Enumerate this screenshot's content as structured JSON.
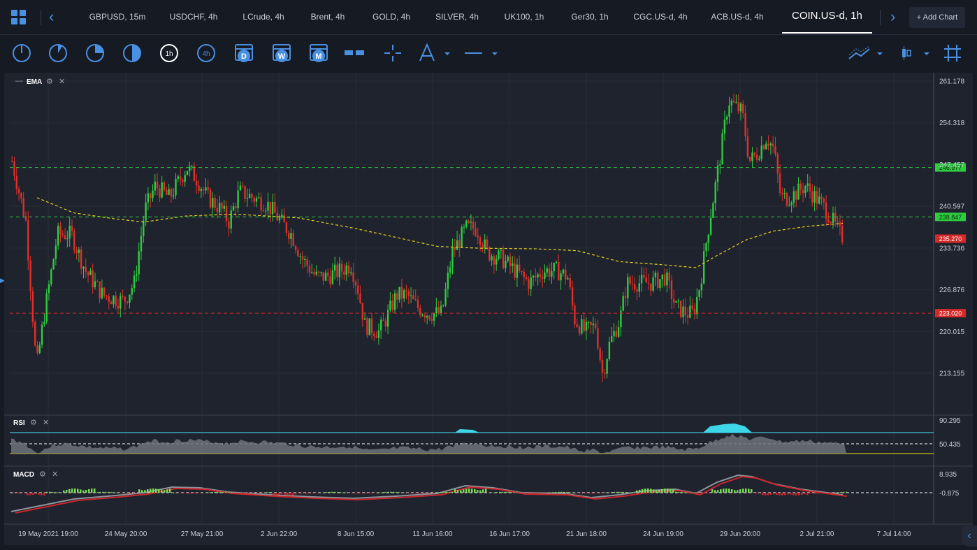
{
  "tabs": [
    {
      "label": "GBPUSD, 15m"
    },
    {
      "label": "USDCHF, 4h"
    },
    {
      "label": "LCrude, 4h"
    },
    {
      "label": "Brent, 4h"
    },
    {
      "label": "GOLD, 4h"
    },
    {
      "label": "SILVER, 4h"
    },
    {
      "label": "UK100, 1h"
    },
    {
      "label": "Ger30, 1h"
    },
    {
      "label": "CGC.US-d, 4h"
    },
    {
      "label": "ACB.US-d, 4h"
    },
    {
      "label": "COIN.US-d, 1h",
      "active": true
    }
  ],
  "add_chart": "+ Add Chart",
  "toolbar": {
    "timeframe_1h_label": "1h",
    "timeframe_4h_label": "4h",
    "day_label": "D",
    "week_label": "W",
    "month_label": "M"
  },
  "indicators": {
    "main": "EMA",
    "rsi": "RSI",
    "macd": "MACD"
  },
  "colors": {
    "up": "#2ecc40",
    "down": "#e0302a",
    "ema": "#e8d21a",
    "green_line": "#2ecc40",
    "red_line": "#d42a2a",
    "accent": "#4a90e2",
    "rsi_fill": "#6f737b",
    "rsi_high": "#3dd6e8",
    "macd_line": "#c8262b"
  },
  "chart_data": {
    "type": "candlestick",
    "y_ticks": [
      "261.178",
      "254.318",
      "247.457",
      "240.597",
      "233.736",
      "226.876",
      "220.015",
      "213.155"
    ],
    "x_ticks": [
      "19 May 2021 19:00",
      "24 May 20:00",
      "27 May 21:00",
      "2 Jun 22:00",
      "8 Jun 15:00",
      "11 Jun 16:00",
      "16 Jun 17:00",
      "21 Jun 18:00",
      "24 Jun 19:00",
      "29 Jun 20:00",
      "2 Jul 21:00",
      "7 Jul 14:00"
    ],
    "ylim": [
      208,
      262
    ],
    "horizontal_lines": [
      {
        "value": 246.977,
        "label": "246.977",
        "color": "green"
      },
      {
        "value": 238.847,
        "label": "238.847",
        "color": "green"
      },
      {
        "value": 223.02,
        "label": "223.020",
        "color": "red"
      }
    ],
    "last_price": {
      "value": 235.27,
      "label": "235.270"
    },
    "rsi": {
      "ticks": [
        "90.295",
        "50.435"
      ]
    },
    "macd": {
      "ticks": [
        "8.935",
        "-0.875"
      ]
    }
  }
}
